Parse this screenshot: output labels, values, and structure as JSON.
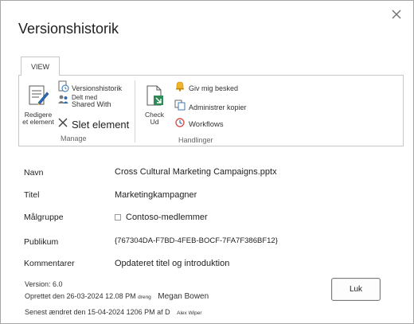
{
  "dialog": {
    "title": "Versionshistorik",
    "close_icon": "close-icon"
  },
  "ribbon": {
    "tab_label": "VIEW",
    "manage": {
      "label": "Manage",
      "edit_item_line1": "Redigere",
      "edit_item_line2": "et element",
      "version_history": "Versionshistorik",
      "shared_with_line1": "Delt med",
      "shared_with_line2": "Shared With",
      "delete_item": "Slet element"
    },
    "actions": {
      "label": "Handlinger",
      "check_out_line1": "Check",
      "check_out_line2": "Ud",
      "alert_me": "Giv mig besked",
      "manage_copies": "Administrer kopier",
      "workflows": "Workflows"
    }
  },
  "fields": [
    {
      "label": "Navn",
      "value": "Cross Cultural Marketing Campaigns.pptx"
    },
    {
      "label": "Titel",
      "value": "Marketingkampagner"
    },
    {
      "label": "Målgruppe",
      "value": "Contoso-medlemmer"
    },
    {
      "label": "Publikum",
      "value": "{767304DA-F7BD-4FEB-BOCF-7FA7F386BF12}"
    },
    {
      "label": "Kommentarer",
      "value": "Opdateret titel og introduktion"
    }
  ],
  "meta": {
    "version": "Version: 6.0",
    "created_prefix": "Oprettet den 26-03-2024 12.08 PM",
    "created_by_word": "dreng",
    "created_user": "Megan Bowen",
    "modified_prefix": "Senest ændret den 15-04-2024 1206 PM af D",
    "modified_user": "Alex Wiper"
  },
  "buttons": {
    "ok": "Luk"
  }
}
